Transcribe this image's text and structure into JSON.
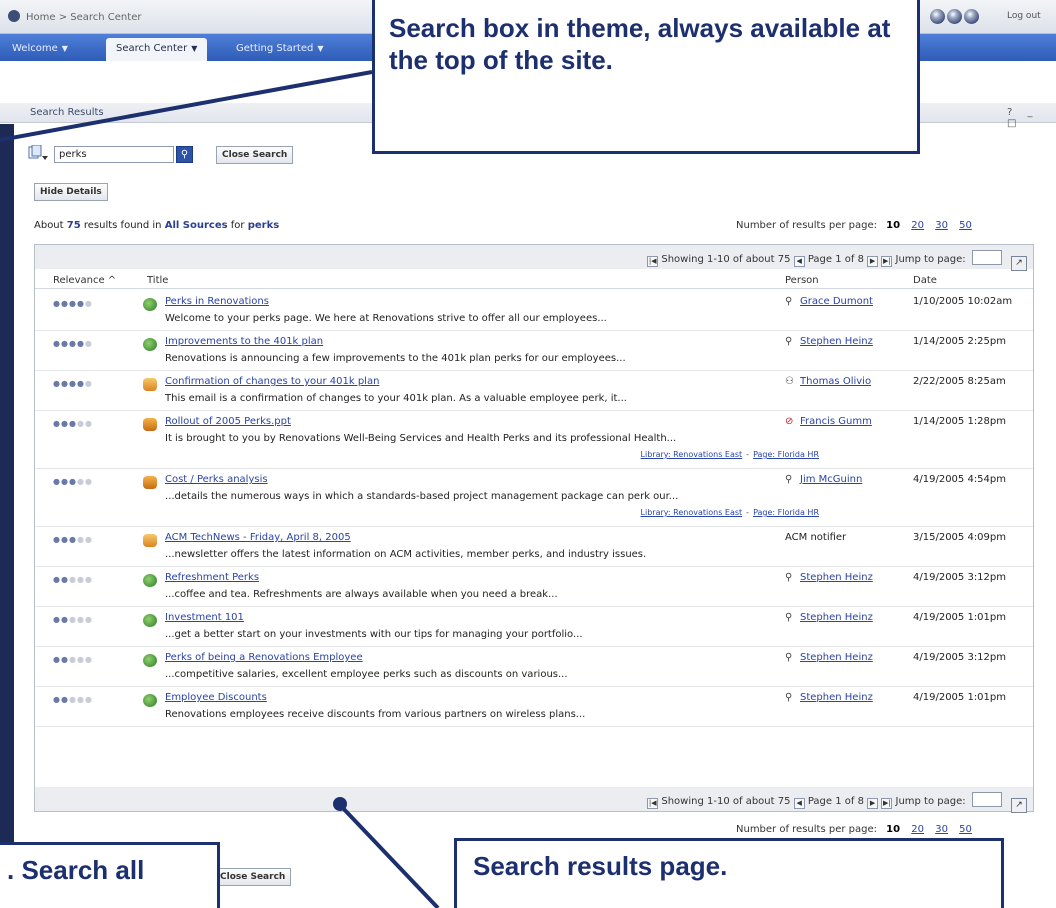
{
  "topbar": {
    "breadcrumb": "Home > Search Center",
    "logout": "Log out"
  },
  "nav": {
    "tabs": [
      {
        "label": "Welcome"
      },
      {
        "label": "Search Center"
      },
      {
        "label": "Getting Started"
      }
    ]
  },
  "webpart": {
    "title": "Search Results",
    "window_controls": "? _ □"
  },
  "search": {
    "value": "perks",
    "close_label": "Close Search",
    "hide_details_label": "Hide Details"
  },
  "summary": {
    "prefix": "About",
    "count": "75",
    "mid": "results found in",
    "scope": "All Sources",
    "for_word": "for",
    "query": "perks"
  },
  "per_page": {
    "label": "Number of results per page:",
    "current": "10",
    "options": [
      "20",
      "30",
      "50"
    ]
  },
  "pager": {
    "showing": "Showing 1-10 of about 75",
    "page": "Page 1 of 8",
    "jump": "Jump to page:"
  },
  "columns": {
    "relevance": "Relevance ^",
    "title": "Title",
    "person": "Person",
    "date": "Date"
  },
  "results": [
    {
      "relevance": 4,
      "icon": "web",
      "title": "Perks in Renovations",
      "desc": "Welcome to your perks page. We here at Renovations strive to offer all our employees...",
      "person": "Grace Dumont",
      "person_icon": "person",
      "date": "1/10/2005 10:02am"
    },
    {
      "relevance": 4,
      "icon": "web",
      "title": "Improvements to the 401k plan",
      "desc": "Renovations is announcing a few improvements to the 401k plan perks for our employees...",
      "person": "Stephen Heinz",
      "person_icon": "person",
      "date": "1/14/2005 2:25pm"
    },
    {
      "relevance": 4,
      "icon": "mail",
      "title": "Confirmation of changes to your 401k plan",
      "desc": "This email is a confirmation of changes to your 401k plan. As a valuable employee perk, it...",
      "person": "Thomas Olivio",
      "person_icon": "group",
      "date": "2/22/2005 8:25am"
    },
    {
      "relevance": 3,
      "icon": "ppt",
      "title": "Rollout of 2005 Perks.ppt",
      "desc": "It is brought to you by Renovations Well-Being Services and Health Perks and its professional Health...",
      "library": "Library: Renovations East",
      "page": "Page: Florida HR",
      "person": "Francis Gumm",
      "person_icon": "busy",
      "date": "1/14/2005 1:28pm"
    },
    {
      "relevance": 3,
      "icon": "ppt",
      "title": "Cost / Perks analysis",
      "desc": "...details the numerous ways in which a standards-based project management package can perk our...",
      "library": "Library: Renovations East",
      "page": "Page: Florida HR",
      "person": "Jim McGuinn",
      "person_icon": "person",
      "date": "4/19/2005 4:54pm"
    },
    {
      "relevance": 3,
      "icon": "mail",
      "title": "ACM TechNews - Friday, April 8, 2005",
      "desc": "...newsletter offers the latest information on ACM activities, member perks, and industry issues.",
      "person": "ACM notifier",
      "person_icon": "none",
      "date": "3/15/2005 4:09pm"
    },
    {
      "relevance": 2,
      "icon": "web",
      "title": "Refreshment Perks",
      "desc": "...coffee and tea.  Refreshments are always available when you need a break...",
      "person": "Stephen Heinz",
      "person_icon": "person",
      "date": "4/19/2005 3:12pm"
    },
    {
      "relevance": 2,
      "icon": "web",
      "title": "Investment 101",
      "desc": "...get a better start on your investments with our tips for managing your portfolio...",
      "person": "Stephen Heinz",
      "person_icon": "person",
      "date": "4/19/2005 1:01pm"
    },
    {
      "relevance": 2,
      "icon": "web",
      "title": "Perks of being a Renovations Employee",
      "desc": "...competitive salaries, excellent employee perks such as discounts on various...",
      "person": "Stephen Heinz",
      "person_icon": "person",
      "date": "4/19/2005 3:12pm"
    },
    {
      "relevance": 2,
      "icon": "web",
      "title": "Employee Discounts",
      "desc": "Renovations employees receive discounts from various partners on wireless plans...",
      "person": "Stephen Heinz",
      "person_icon": "person",
      "date": "4/19/2005 1:01pm"
    }
  ],
  "callouts": {
    "top": "Search box in theme, always available at the top of the site.",
    "bottom_left": ". Search all",
    "bottom_right": "Search results page."
  }
}
